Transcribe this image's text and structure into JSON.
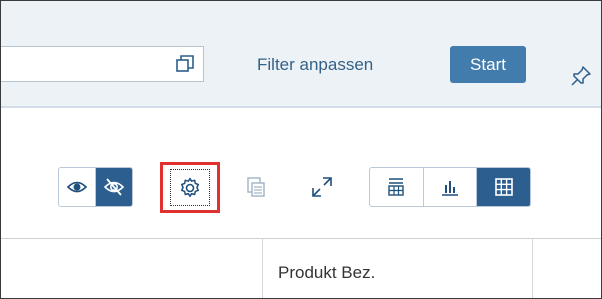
{
  "filterbar": {
    "filter_link": "Filter anpassen",
    "start_label": "Start",
    "search_value": ""
  },
  "toolbar": {
    "visibility_toggle": [
      "eye-icon",
      "eye-slash-icon"
    ],
    "visibility_selected": "eye-slash-icon",
    "view_switch": [
      "table-list-icon",
      "bar-chart-icon",
      "grid-icon"
    ],
    "view_selected": "grid-icon",
    "settings_icon": "gear-icon",
    "settings_highlight_color": "#e03030"
  },
  "colors": {
    "accent": "#427cac",
    "active_segment": "#2c5f8f",
    "link": "#346187",
    "filterbar_bg": "#edf2f7"
  },
  "table": {
    "columns": [
      "",
      "Produkt Bez."
    ]
  }
}
